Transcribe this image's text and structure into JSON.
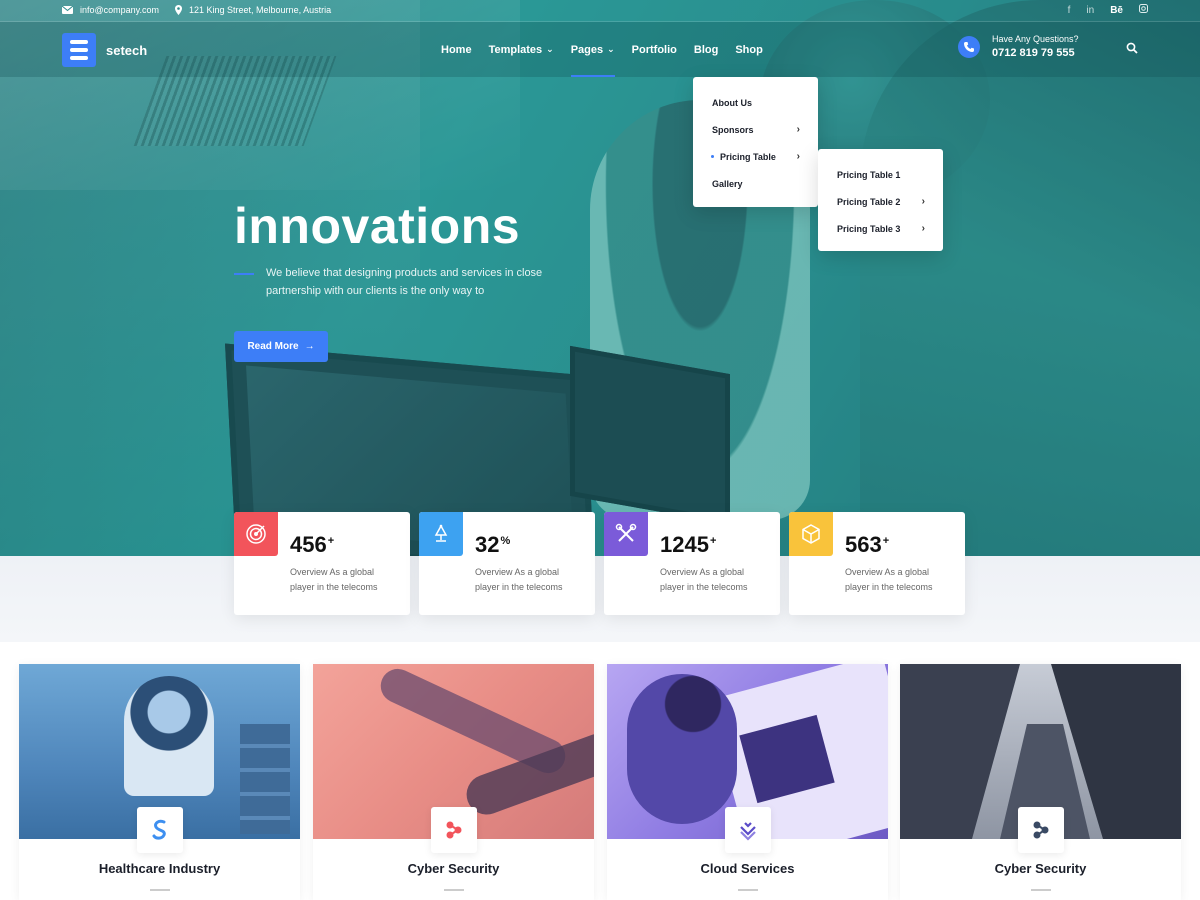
{
  "topbar": {
    "email": "info@company.com",
    "address": "121 King Street, Melbourne, Austria",
    "social": [
      "f",
      "in",
      "Bē",
      "ig"
    ]
  },
  "brand": {
    "name": "setech",
    "accent": "#3d7ef7"
  },
  "nav": {
    "items": [
      {
        "label": "Home",
        "has_dropdown": false
      },
      {
        "label": "Templates",
        "has_dropdown": true
      },
      {
        "label": "Pages",
        "has_dropdown": true,
        "active": true
      },
      {
        "label": "Portfolio",
        "has_dropdown": false
      },
      {
        "label": "Blog",
        "has_dropdown": false
      },
      {
        "label": "Shop",
        "has_dropdown": false
      }
    ]
  },
  "contact": {
    "question": "Have Any Questions?",
    "phone": "0712 819 79 555"
  },
  "pages_menu": [
    {
      "label": "About Us",
      "submenu": false
    },
    {
      "label": "Sponsors",
      "submenu": true
    },
    {
      "label": "Pricing Table",
      "submenu": true,
      "current": true
    },
    {
      "label": "Gallery",
      "submenu": false
    }
  ],
  "pricing_submenu": [
    {
      "label": "Pricing Table 1",
      "submenu": false
    },
    {
      "label": "Pricing Table 2",
      "submenu": true
    },
    {
      "label": "Pricing Table 3",
      "submenu": true
    }
  ],
  "hero": {
    "title": "innovations",
    "text": "We believe that designing products and services in close partnership with our clients is the only way to",
    "button": "Read More"
  },
  "stats": [
    {
      "value": "456",
      "suffix": "+",
      "desc": "Overview As a global player in the telecoms",
      "color": "#f2545b",
      "icon": "target-icon"
    },
    {
      "value": "32",
      "suffix": "%",
      "desc": "Overview As a global player in the telecoms",
      "color": "#3da2f1",
      "icon": "lamp-icon"
    },
    {
      "value": "1245",
      "suffix": "+",
      "desc": "Overview As a global player in the telecoms",
      "color": "#7b5bd9",
      "icon": "tools-icon"
    },
    {
      "value": "563",
      "suffix": "+",
      "desc": "Overview As a global player in the telecoms",
      "color": "#f9c33b",
      "icon": "cube-icon"
    }
  ],
  "services": [
    {
      "title": "Healthcare Industry",
      "icon": "s-logo-icon",
      "icon_color": "#3d8ff0"
    },
    {
      "title": "Cyber Security",
      "icon": "nodes-icon",
      "icon_color": "#f2545b"
    },
    {
      "title": "Cloud Services",
      "icon": "layers-icon",
      "icon_color": "#5a4bc8"
    },
    {
      "title": "Cyber Security",
      "icon": "nodes-icon",
      "icon_color": "#3a4a64"
    }
  ]
}
